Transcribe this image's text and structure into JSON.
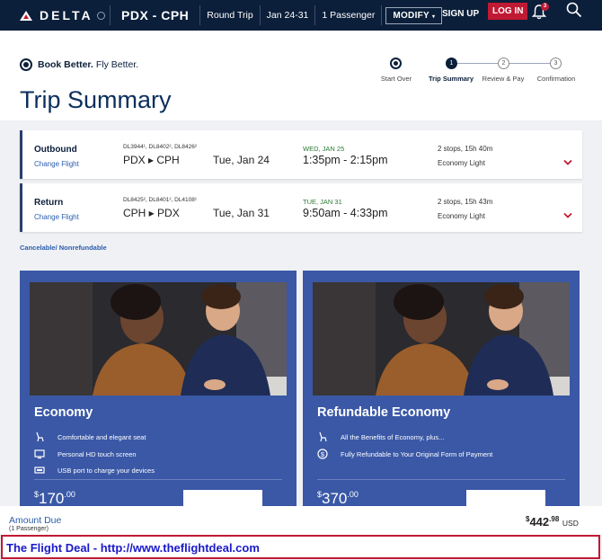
{
  "nav": {
    "brand": "DELTA",
    "route": "PDX - CPH",
    "trip_type": "Round Trip",
    "dates": "Jan 24-31",
    "passengers": "1 Passenger",
    "modify": "MODIFY",
    "signup": "SIGN UP",
    "login": "LOG IN",
    "notification_count": "3"
  },
  "header": {
    "tagline_bold": "Book Better.",
    "tagline_rest": "Fly Better.",
    "title": "Trip Summary"
  },
  "steps": [
    {
      "label": "Start Over",
      "number": ""
    },
    {
      "label": "Trip Summary",
      "number": "1"
    },
    {
      "label": "Review & Pay",
      "number": "2"
    },
    {
      "label": "Confirmation",
      "number": "3"
    }
  ],
  "flights": [
    {
      "direction": "Outbound",
      "change": "Change Flight",
      "flight_numbers": "DL3944¹, DL8402², DL8426²",
      "route": "PDX ▸ CPH",
      "date": "Tue, Jan 24",
      "arrival_day": "WED, JAN 25",
      "times": "1:35pm - 2:15pm",
      "stops": "2 stops,  15h 40m",
      "cabin": "Economy Light"
    },
    {
      "direction": "Return",
      "change": "Change Flight",
      "flight_numbers": "DL8425², DL8401², DL4108¹",
      "route": "CPH ▸ PDX",
      "date": "Tue, Jan 31",
      "arrival_day": "TUE, JAN 31",
      "times": "9:50am - 4:33pm",
      "stops": "2 stops,  15h 43m",
      "cabin": "Economy Light"
    }
  ],
  "cancel_note": "Cancelable/ Nonrefundable",
  "fares": [
    {
      "name": "Economy",
      "features": [
        {
          "icon": "seat-icon",
          "text": "Comfortable and elegant seat"
        },
        {
          "icon": "screen-icon",
          "text": "Personal HD touch screen"
        },
        {
          "icon": "usb-icon",
          "text": "USB port to charge your devices"
        }
      ],
      "price_whole": "170",
      "price_cents": ".00"
    },
    {
      "name": "Refundable Economy",
      "features": [
        {
          "icon": "seat-icon",
          "text": "All the Benefits of Economy, plus..."
        },
        {
          "icon": "refund-icon",
          "text": "Fully Refundable to Your Original Form of Payment"
        }
      ],
      "price_whole": "370",
      "price_cents": ".00"
    }
  ],
  "amount": {
    "label": "Amount Due",
    "sub": "(1 Passenger)",
    "whole": "442",
    "cents": ".98",
    "currency": "USD"
  },
  "deal_banner": "The Flight Deal - http://www.theflightdeal.com",
  "colors": {
    "nav_bg": "#0b1f3a",
    "brand_red": "#c01933",
    "fare_blue": "#3a58a6",
    "link_blue": "#2a5dac",
    "arrival_green": "#2c7a34"
  }
}
